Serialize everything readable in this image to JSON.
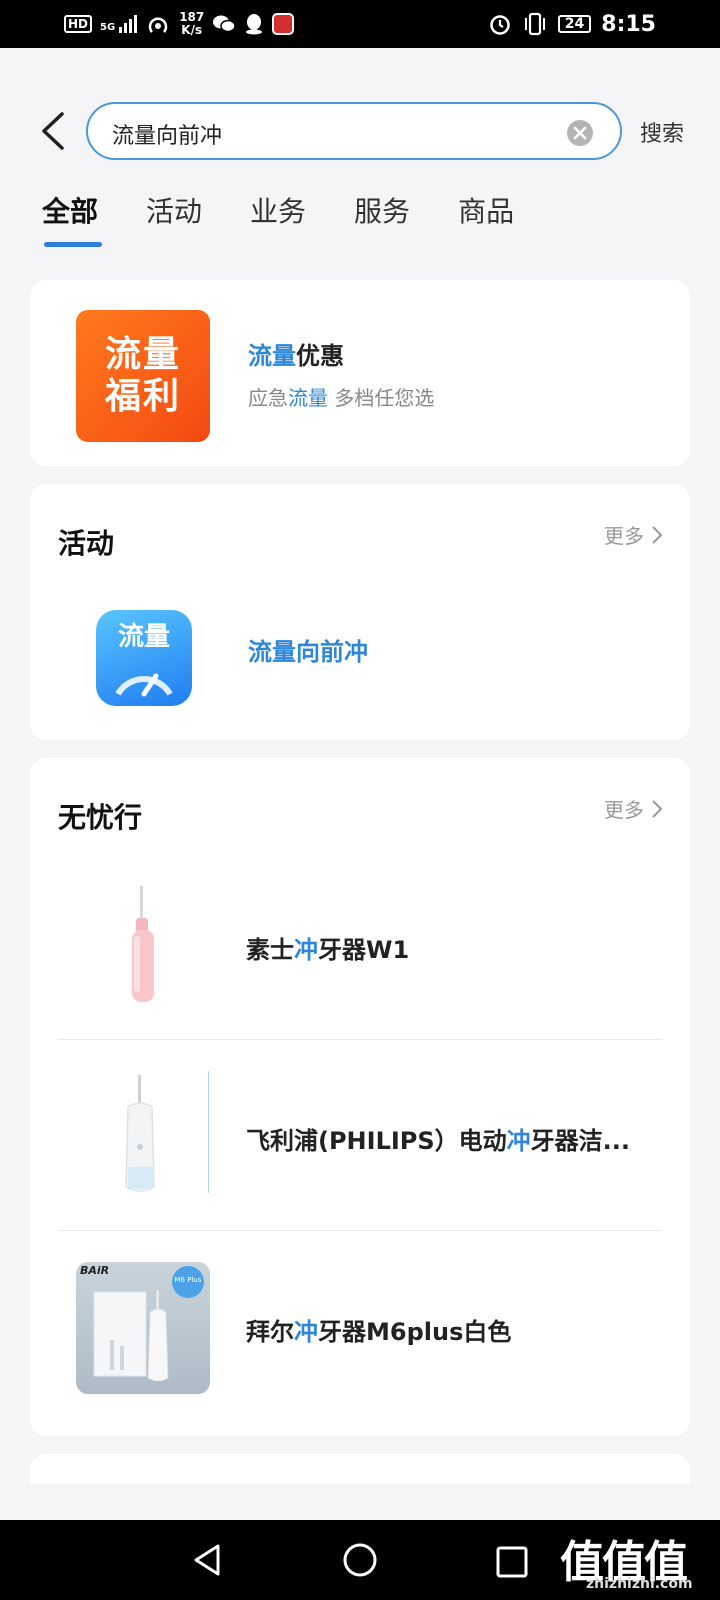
{
  "status_bar": {
    "network_badge": "HD",
    "signal_label": "5G",
    "speed_value": "187",
    "speed_unit": "K/s",
    "battery": "24",
    "time": "8:15",
    "icons": [
      "hd-icon",
      "signal-icon",
      "hotspot-icon",
      "wechat-icon",
      "qq-icon",
      "app-icon",
      "alarm-icon",
      "vibrate-icon",
      "battery-icon"
    ]
  },
  "search": {
    "query": "流量向前冲",
    "button_label": "搜索"
  },
  "tabs": [
    {
      "label": "全部",
      "active": true
    },
    {
      "label": "活动",
      "active": false
    },
    {
      "label": "业务",
      "active": false
    },
    {
      "label": "服务",
      "active": false
    },
    {
      "label": "商品",
      "active": false
    }
  ],
  "promo": {
    "image_text": "流量福利",
    "title_highlight": "流量",
    "title_rest": "优惠",
    "sub_pre": "应急",
    "sub_highlight": "流量",
    "sub_post": " 多档任您选"
  },
  "activity_section": {
    "title": "活动",
    "more_label": "更多",
    "item": {
      "icon_text": "流量",
      "title": "流量向前冲"
    }
  },
  "products_section": {
    "title": "无忧行",
    "more_label": "更多",
    "items": [
      {
        "pre": "素士",
        "hl": "冲",
        "post": "牙器W1"
      },
      {
        "pre": "飞利浦(PHILIPS）电动",
        "hl": "冲",
        "post": "牙器洁..."
      },
      {
        "pre": "拜尔",
        "hl": "冲",
        "post": "牙器M6plus白色"
      }
    ],
    "brand_badge": "BAiR",
    "box_label": "M6 Plus"
  },
  "navbar": {
    "watermark": "值值值",
    "watermark_url": "zhizhizhi.com"
  },
  "colors": {
    "accent": "#2e86d8",
    "search_border": "#4a98d8",
    "tab_indicator": "#2d7fd6",
    "promo_bg": "#f34a12",
    "activity_icon": "#1e7df0",
    "background": "#f5f5f7"
  }
}
